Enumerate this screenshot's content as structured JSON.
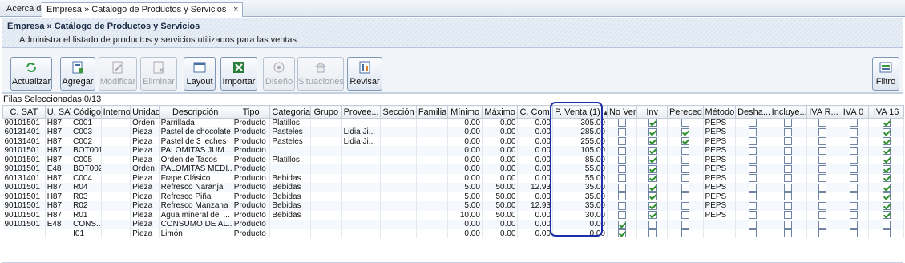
{
  "tabs": [
    {
      "label": "Acerca de"
    },
    {
      "label": "Empresa » Catálogo de Productos y Servicios",
      "close": "×"
    }
  ],
  "header": {
    "title": "Empresa » Catálogo de Productos y Servicios",
    "subtitle": "Administra el listado de productos y servicios utilizados para las ventas"
  },
  "toolbar": {
    "actualizar": "Actualizar",
    "agregar": "Agregar",
    "modificar": "Modificar",
    "eliminar": "Eliminar",
    "layout": "Layout",
    "importar": "Importar",
    "diseno": "Diseño",
    "situaciones": "Situaciones",
    "revisar": "Revisar",
    "filtro": "Filtro"
  },
  "grid": {
    "selection_label": "Filas Seleccionadas 0/13",
    "columns": [
      "C. SAT",
      "U. SAT",
      "Código",
      "Interno",
      "Unidad",
      "Descripción",
      "Tipo",
      "Categoria",
      "Grupo",
      "Provee...",
      "Sección",
      "Familia",
      "Mínimo",
      "Máximo",
      "C. Com...",
      "P. Venta (1)",
      "No Venta",
      "Inv",
      "Pereced...",
      "Método",
      "Desha...",
      "Incluye...",
      "IVA R...",
      "IVA 0",
      "IVA 16"
    ],
    "sorted_column_arrow": "▲",
    "rows": [
      {
        "csat": "90101501",
        "usat": "H87",
        "codigo": "C001",
        "interno": "",
        "unidad": "Orden",
        "desc": "Parrillada",
        "tipo": "Producto",
        "cat": "Platillos",
        "grupo": "",
        "prov": "",
        "seccion": "",
        "familia": "",
        "min": "0.00",
        "max": "0.00",
        "ccom": "0.00",
        "pventa": "305.00",
        "noventa": false,
        "inv": true,
        "perec": false,
        "metodo": "PEPS",
        "desha": false,
        "incluye": false,
        "ivar": false,
        "iva0": false,
        "iva16": true
      },
      {
        "csat": "60131401",
        "usat": "H87",
        "codigo": "C003",
        "interno": "",
        "unidad": "Pieza",
        "desc": "Pastel de chocolate",
        "tipo": "Producto",
        "cat": "Pasteles",
        "grupo": "",
        "prov": "Lidia Ji...",
        "seccion": "",
        "familia": "",
        "min": "0.00",
        "max": "0.00",
        "ccom": "0.00",
        "pventa": "285.00",
        "noventa": false,
        "inv": true,
        "perec": true,
        "metodo": "PEPS",
        "desha": false,
        "incluye": false,
        "ivar": false,
        "iva0": false,
        "iva16": true
      },
      {
        "csat": "60131401",
        "usat": "H87",
        "codigo": "C002",
        "interno": "",
        "unidad": "Pieza",
        "desc": "Pastel de 3 leches",
        "tipo": "Producto",
        "cat": "Pasteles",
        "grupo": "",
        "prov": "Lidia Ji...",
        "seccion": "",
        "familia": "",
        "min": "0.00",
        "max": "0.00",
        "ccom": "0.00",
        "pventa": "255.00",
        "noventa": false,
        "inv": true,
        "perec": true,
        "metodo": "PEPS",
        "desha": false,
        "incluye": false,
        "ivar": false,
        "iva0": false,
        "iva16": true
      },
      {
        "csat": "90101501",
        "usat": "H87",
        "codigo": "BOT001",
        "interno": "",
        "unidad": "Pieza",
        "desc": "PALOMITAS JUM...",
        "tipo": "Producto",
        "cat": "",
        "grupo": "",
        "prov": "",
        "seccion": "",
        "familia": "",
        "min": "0.00",
        "max": "0.00",
        "ccom": "0.00",
        "pventa": "105.00",
        "noventa": false,
        "inv": true,
        "perec": false,
        "metodo": "PEPS",
        "desha": false,
        "incluye": false,
        "ivar": false,
        "iva0": false,
        "iva16": true
      },
      {
        "csat": "90101501",
        "usat": "H87",
        "codigo": "C005",
        "interno": "",
        "unidad": "Pieza",
        "desc": "Orden de Tacos",
        "tipo": "Producto",
        "cat": "Platillos",
        "grupo": "",
        "prov": "",
        "seccion": "",
        "familia": "",
        "min": "0.00",
        "max": "0.00",
        "ccom": "0.00",
        "pventa": "85.00",
        "noventa": false,
        "inv": true,
        "perec": false,
        "metodo": "PEPS",
        "desha": false,
        "incluye": false,
        "ivar": false,
        "iva0": false,
        "iva16": true
      },
      {
        "csat": "90101501",
        "usat": "E48",
        "codigo": "BOT002",
        "interno": "",
        "unidad": "Orden",
        "desc": "PALOMITAS MEDI...",
        "tipo": "Producto",
        "cat": "",
        "grupo": "",
        "prov": "",
        "seccion": "",
        "familia": "",
        "min": "0.00",
        "max": "0.00",
        "ccom": "0.00",
        "pventa": "55.00",
        "noventa": false,
        "inv": true,
        "perec": false,
        "metodo": "PEPS",
        "desha": false,
        "incluye": false,
        "ivar": false,
        "iva0": false,
        "iva16": true
      },
      {
        "csat": "60131401",
        "usat": "H87",
        "codigo": "C004",
        "interno": "",
        "unidad": "Pieza",
        "desc": "Frape Clásico",
        "tipo": "Producto",
        "cat": "Bebidas",
        "grupo": "",
        "prov": "",
        "seccion": "",
        "familia": "",
        "min": "0.00",
        "max": "0.00",
        "ccom": "0.00",
        "pventa": "55.00",
        "noventa": false,
        "inv": true,
        "perec": false,
        "metodo": "PEPS",
        "desha": false,
        "incluye": false,
        "ivar": false,
        "iva0": false,
        "iva16": true
      },
      {
        "csat": "90101501",
        "usat": "H87",
        "codigo": "R04",
        "interno": "",
        "unidad": "Pieza",
        "desc": "Refresco Naranja",
        "tipo": "Producto",
        "cat": "Bebidas",
        "grupo": "",
        "prov": "",
        "seccion": "",
        "familia": "",
        "min": "5.00",
        "max": "50.00",
        "ccom": "12.93",
        "pventa": "35.00",
        "noventa": false,
        "inv": true,
        "perec": false,
        "metodo": "PEPS",
        "desha": false,
        "incluye": false,
        "ivar": false,
        "iva0": false,
        "iva16": true
      },
      {
        "csat": "90101501",
        "usat": "H87",
        "codigo": "R03",
        "interno": "",
        "unidad": "Pieza",
        "desc": "Refresco Piña",
        "tipo": "Producto",
        "cat": "Bebidas",
        "grupo": "",
        "prov": "",
        "seccion": "",
        "familia": "",
        "min": "5.00",
        "max": "50.00",
        "ccom": "0.00",
        "pventa": "35.00",
        "noventa": false,
        "inv": true,
        "perec": false,
        "metodo": "PEPS",
        "desha": false,
        "incluye": false,
        "ivar": false,
        "iva0": false,
        "iva16": true
      },
      {
        "csat": "90101501",
        "usat": "H87",
        "codigo": "R02",
        "interno": "",
        "unidad": "Pieza",
        "desc": "Refresco Manzana",
        "tipo": "Producto",
        "cat": "Bebidas",
        "grupo": "",
        "prov": "",
        "seccion": "",
        "familia": "",
        "min": "5.00",
        "max": "50.00",
        "ccom": "12.93",
        "pventa": "35.00",
        "noventa": false,
        "inv": true,
        "perec": false,
        "metodo": "PEPS",
        "desha": false,
        "incluye": false,
        "ivar": false,
        "iva0": false,
        "iva16": true
      },
      {
        "csat": "90101501",
        "usat": "H87",
        "codigo": "R01",
        "interno": "",
        "unidad": "Pieza",
        "desc": "Agua mineral del ...",
        "tipo": "Producto",
        "cat": "Bebidas",
        "grupo": "",
        "prov": "",
        "seccion": "",
        "familia": "",
        "min": "10.00",
        "max": "50.00",
        "ccom": "0.00",
        "pventa": "30.00",
        "noventa": false,
        "inv": true,
        "perec": false,
        "metodo": "PEPS",
        "desha": false,
        "incluye": false,
        "ivar": false,
        "iva0": false,
        "iva16": true
      },
      {
        "csat": "90101501",
        "usat": "E48",
        "codigo": "CONS...",
        "interno": "",
        "unidad": "Pieza",
        "desc": "CONSUMO DE AL...",
        "tipo": "Producto",
        "cat": "",
        "grupo": "",
        "prov": "",
        "seccion": "",
        "familia": "",
        "min": "0.00",
        "max": "0.00",
        "ccom": "0.00",
        "pventa": "0.00",
        "noventa": true,
        "inv": false,
        "perec": false,
        "metodo": "",
        "desha": false,
        "incluye": false,
        "ivar": false,
        "iva0": false,
        "iva16": false
      },
      {
        "csat": "",
        "usat": "",
        "codigo": "I01",
        "interno": "",
        "unidad": "Pieza",
        "desc": "Limón",
        "tipo": "Producto",
        "cat": "",
        "grupo": "",
        "prov": "",
        "seccion": "",
        "familia": "",
        "min": "0.00",
        "max": "0.00",
        "ccom": "0.00",
        "pventa": "0.00",
        "noventa": true,
        "inv": false,
        "perec": false,
        "metodo": "",
        "desha": false,
        "incluye": false,
        "ivar": false,
        "iva0": false,
        "iva16": false
      }
    ]
  }
}
